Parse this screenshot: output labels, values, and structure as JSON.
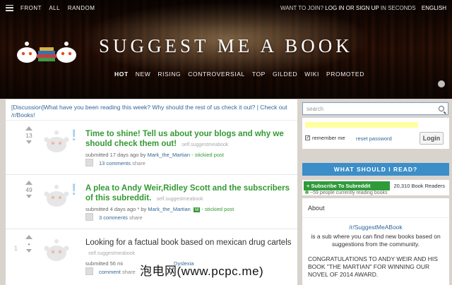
{
  "topbar": {
    "nav": [
      "FRONT",
      "ALL",
      "RANDOM"
    ],
    "want_to_join": "WANT TO JOIN?",
    "login_signup": "LOG IN OR SIGN UP",
    "in_seconds": "IN SECONDS",
    "language": "ENGLISH"
  },
  "header": {
    "title": "SUGGEST ME A BOOK",
    "tabs": [
      "HOT",
      "NEW",
      "RISING",
      "CONTROVERSIAL",
      "TOP",
      "GILDED",
      "WIKI",
      "PROMOTED"
    ]
  },
  "announcement": "[Discussion]What have you been reading this week? Why should the rest of us check it out? | Check out /r/Books!",
  "posts": [
    {
      "score": "13",
      "title": "Time to shine! Tell us about your blogs and why we should check them out!",
      "domain": "self.suggestmeabook",
      "submitted": "submitted 17 days ago by",
      "author": "Mark_the_Martian",
      "stickied": "- stickied post",
      "comments": "13 comments",
      "share": "share"
    },
    {
      "score": "49",
      "title": "A plea to Andy Weir,Ridley Scott and the subscribers of this subreddit.",
      "domain": "self.suggestmeabook",
      "submitted": "submitted 4 days ago * by",
      "author": "Mark_the_Martian",
      "mod": "M",
      "stickied": "- stickied post",
      "comments": "3 comments",
      "share": "share"
    },
    {
      "rank": "1",
      "score": "•",
      "title": "Looking for a factual book based on mexican drug cartels",
      "domain": "self.suggestmeabook",
      "submitted": "submitted 56 mi",
      "flair": "Dyslexia",
      "comments": "comment",
      "share": "share"
    }
  ],
  "sidebar": {
    "search_placeholder": "search",
    "remember_me": "remember me",
    "reset_password": "reset password",
    "login_button": "Login",
    "what_should_i_read": "WHAT SHOULD I READ?",
    "subscribe": "+ Subscribe To Subreddit",
    "readers": "20,310 Book Readers",
    "online": "~59 people currently reading books",
    "about_title": "About",
    "about_link": "/r/SuggestMeABook",
    "about_desc": "is a sub where you can find new books based on suggestions from the community.",
    "about_congrats": "CONGRATULATIONS TO ANDY WEIR AND HIS BOOK \"THE MARTIAN\" FOR WINNING OUR NOVEL OF 2014 AWARD."
  },
  "watermark": "泡电网(www.pcpc.me)",
  "colors": {
    "sticky_title": "#339933",
    "link": "#336699",
    "read_button": "#3b8ec8",
    "subscribe_button": "#2e9b3a"
  },
  "icons": [
    "menu-icon",
    "reddit-alien-logo",
    "upvote-icon",
    "downvote-icon",
    "search-icon",
    "checkbox-icon",
    "expando-icon"
  ]
}
